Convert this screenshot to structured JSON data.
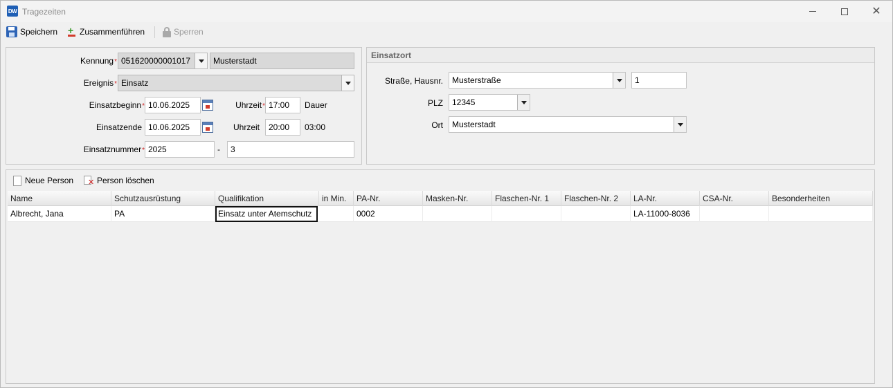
{
  "window": {
    "app_icon": "DW",
    "title": "Tragezeiten"
  },
  "toolbar": {
    "save_label": "Speichern",
    "merge_label": "Zusammenführen",
    "lock_label": "Sperren"
  },
  "form": {
    "kennung_label": "Kennung",
    "kennung_value": "051620000001017",
    "kennung_name": "Musterstadt",
    "ereignis_label": "Ereignis",
    "ereignis_value": "Einsatz",
    "beginn_label": "Einsatzbeginn",
    "beginn_date": "10.06.2025",
    "uhrzeit_label": "Uhrzeit",
    "beginn_time": "17:00",
    "dauer_label": "Dauer",
    "ende_label": "Einsatzende",
    "ende_date": "10.06.2025",
    "ende_time": "20:00",
    "dauer_value": "03:00",
    "nummer_label": "Einsatznummer",
    "nummer_year": "2025",
    "nummer_sep": "-",
    "nummer_value": "3",
    "required_mark": "*"
  },
  "einsatzort": {
    "header": "Einsatzort",
    "strasse_label": "Straße, Hausnr.",
    "strasse_value": "Musterstraße",
    "hausnr_value": "1",
    "plz_label": "PLZ",
    "plz_value": "12345",
    "ort_label": "Ort",
    "ort_value": "Musterstadt"
  },
  "persons": {
    "new_label": "Neue Person",
    "delete_label": "Person löschen",
    "columns": [
      "Name",
      "Schutzausrüstung",
      "Qualifikation",
      "in Min.",
      "PA-Nr.",
      "Masken-Nr.",
      "Flaschen-Nr. 1",
      "Flaschen-Nr. 2",
      "LA-Nr.",
      "CSA-Nr.",
      "Besonderheiten"
    ],
    "rows": [
      [
        "Albrecht, Jana",
        "PA",
        "Einsatz unter Atemschutz",
        "",
        "0002",
        "",
        "",
        "",
        "LA-11000-8036",
        "",
        ""
      ]
    ]
  }
}
